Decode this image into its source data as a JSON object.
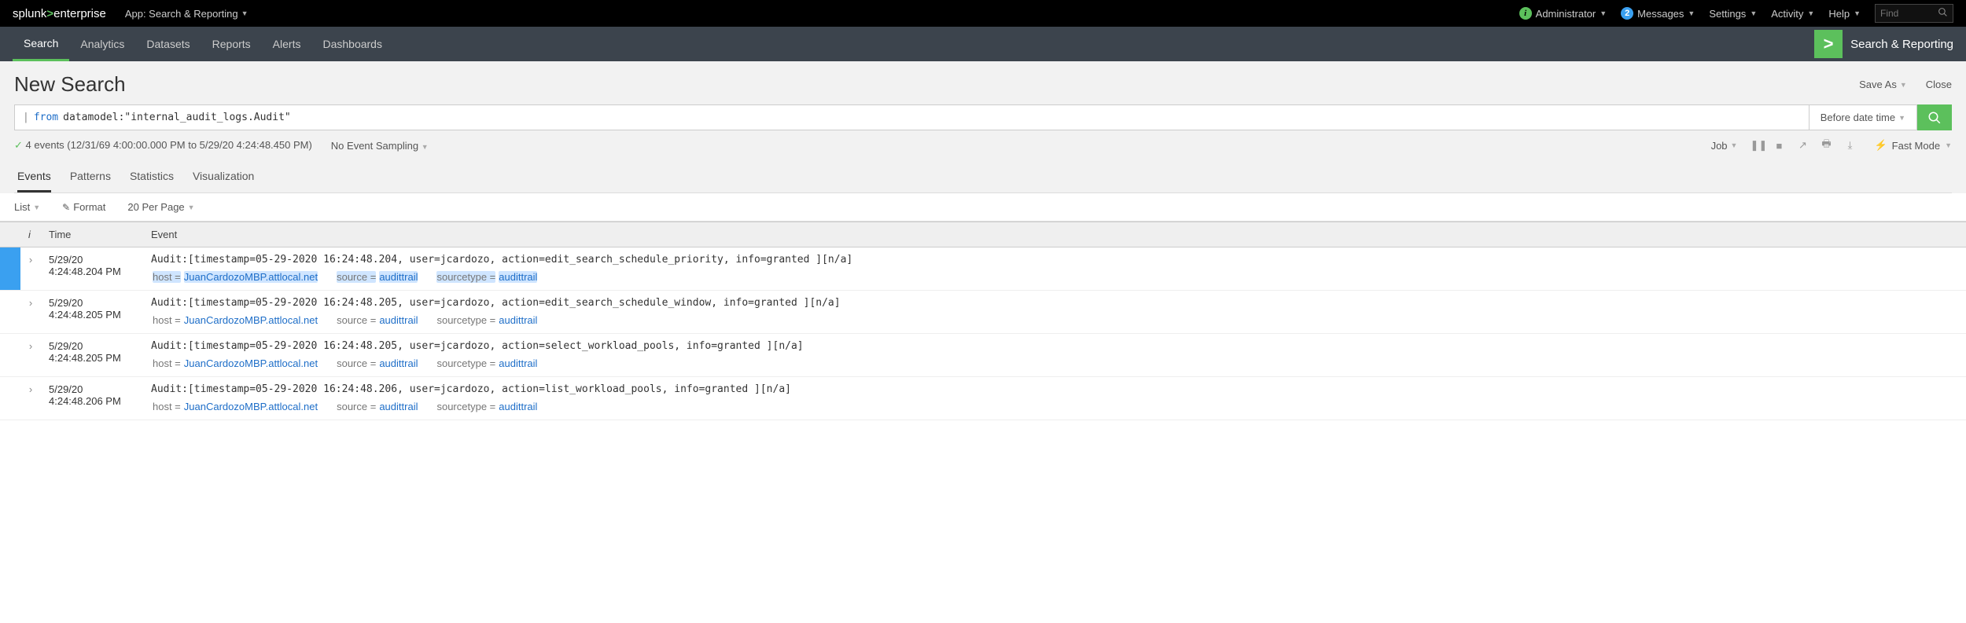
{
  "topbar": {
    "logo_pre": "splunk",
    "logo_sym": ">",
    "logo_post": "enterprise",
    "app_label": "App: Search & Reporting",
    "admin": "Administrator",
    "messages": "Messages",
    "messages_count": "2",
    "settings": "Settings",
    "activity": "Activity",
    "help": "Help",
    "find_placeholder": "Find"
  },
  "nav": {
    "items": [
      "Search",
      "Analytics",
      "Datasets",
      "Reports",
      "Alerts",
      "Dashboards"
    ],
    "active": "Search",
    "app_title": "Search & Reporting"
  },
  "page": {
    "title": "New Search",
    "save_as": "Save As",
    "close": "Close"
  },
  "search": {
    "pipe": "|",
    "keyword": "from",
    "rest": " datamodel:\"internal_audit_logs.Audit\"",
    "time_label": "Before date time"
  },
  "status": {
    "events_line": "4 events (12/31/69 4:00:00.000 PM to 5/29/20 4:24:48.450 PM)",
    "sampling": "No Event Sampling",
    "job": "Job",
    "mode": "Fast Mode"
  },
  "tabs": {
    "items": [
      "Events",
      "Patterns",
      "Statistics",
      "Visualization"
    ],
    "active": "Events"
  },
  "listbar": {
    "list": "List",
    "format": "Format",
    "perpage": "20 Per Page"
  },
  "table": {
    "col_i": "i",
    "col_time": "Time",
    "col_event": "Event",
    "rows": [
      {
        "date": "5/29/20",
        "time": "4:24:48.204 PM",
        "raw": "Audit:[timestamp=05-29-2020 16:24:48.204, user=jcardozo, action=edit_search_schedule_priority, info=granted ][n/a]",
        "host": "JuanCardozoMBP.attlocal.net",
        "source": "audittrail",
        "sourcetype": "audittrail",
        "selected": true
      },
      {
        "date": "5/29/20",
        "time": "4:24:48.205 PM",
        "raw": "Audit:[timestamp=05-29-2020 16:24:48.205, user=jcardozo, action=edit_search_schedule_window, info=granted ][n/a]",
        "host": "JuanCardozoMBP.attlocal.net",
        "source": "audittrail",
        "sourcetype": "audittrail",
        "selected": false
      },
      {
        "date": "5/29/20",
        "time": "4:24:48.205 PM",
        "raw": "Audit:[timestamp=05-29-2020 16:24:48.205, user=jcardozo, action=select_workload_pools, info=granted ][n/a]",
        "host": "JuanCardozoMBP.attlocal.net",
        "source": "audittrail",
        "sourcetype": "audittrail",
        "selected": false
      },
      {
        "date": "5/29/20",
        "time": "4:24:48.206 PM",
        "raw": "Audit:[timestamp=05-29-2020 16:24:48.206, user=jcardozo, action=list_workload_pools, info=granted ][n/a]",
        "host": "JuanCardozoMBP.attlocal.net",
        "source": "audittrail",
        "sourcetype": "audittrail",
        "selected": false
      }
    ],
    "labels": {
      "host": "host =",
      "source": "source =",
      "sourcetype": "sourcetype ="
    }
  }
}
